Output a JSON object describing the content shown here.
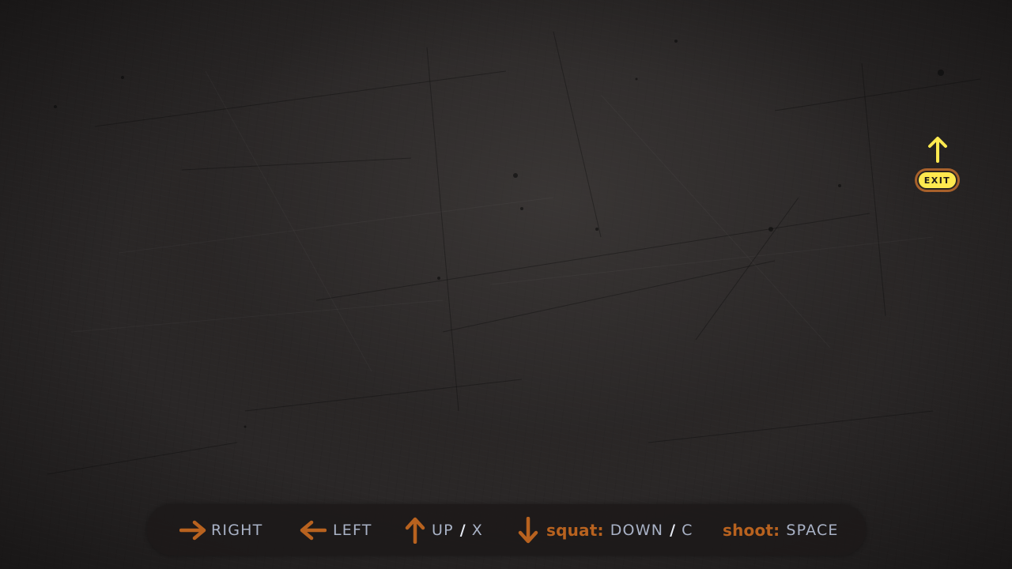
{
  "colors": {
    "background": "#2a2727",
    "accent_orange": "#b8621f",
    "exit_yellow": "#ffe94f",
    "exit_border": "#a8612b",
    "key_text": "#a9b2c6",
    "separator": "#e8ecf5"
  },
  "exit": {
    "label": "EXIT",
    "arrow_icon": "up-arrow-icon"
  },
  "controls": {
    "right": {
      "icon": "right-arrow-icon",
      "key": "RIGHT"
    },
    "left": {
      "icon": "left-arrow-icon",
      "key": "LEFT"
    },
    "up": {
      "icon": "up-arrow-icon",
      "key": "UP",
      "separator": "/",
      "alt_key": "X"
    },
    "squat": {
      "icon": "down-arrow-icon",
      "action": "squat:",
      "key": "DOWN",
      "separator": "/",
      "alt_key": "C"
    },
    "shoot": {
      "action": "shoot:",
      "key": "SPACE"
    }
  }
}
